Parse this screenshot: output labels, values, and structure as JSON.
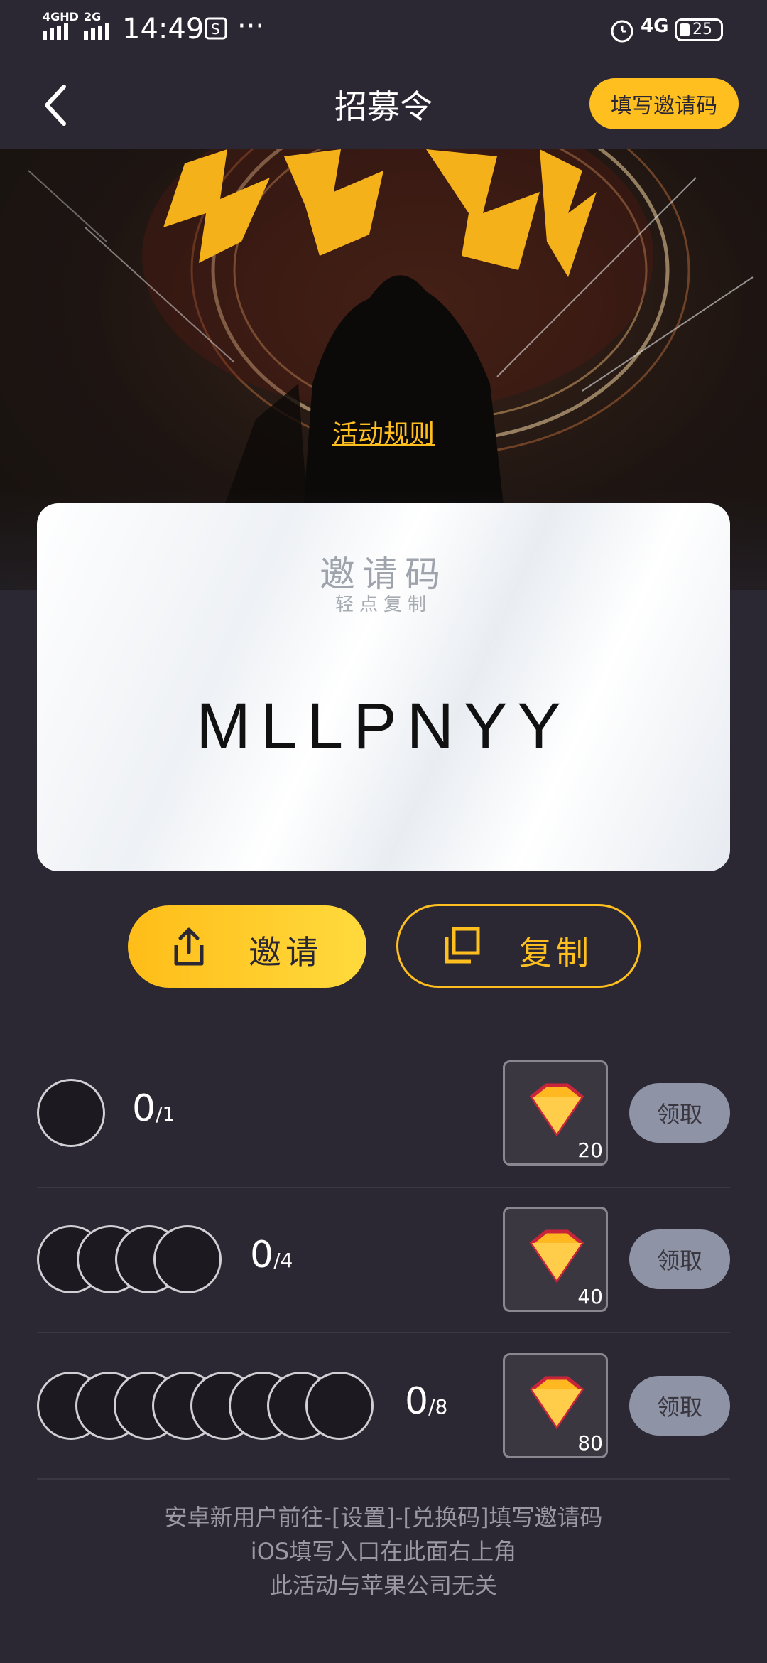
{
  "status_bar": {
    "network_left": "4GHD",
    "network_right": "2G",
    "time": "14:49",
    "more": "···",
    "right_network": "4G",
    "battery": "25"
  },
  "header": {
    "title": "招募令",
    "fill_code_label": "填写邀请码"
  },
  "banner": {
    "rules_link": "活动规则"
  },
  "card": {
    "title": "邀请码",
    "subtitle": "轻点复制",
    "code": "MLLPNYY"
  },
  "actions": {
    "invite_label": "邀请",
    "copy_label": "复制"
  },
  "rows": [
    {
      "count": "0",
      "total": "/1",
      "reward": "20",
      "claim": "领取"
    },
    {
      "count": "0",
      "total": "/4",
      "reward": "40",
      "claim": "领取"
    },
    {
      "count": "0",
      "total": "/8",
      "reward": "80",
      "claim": "领取"
    }
  ],
  "footer": {
    "line1": "安卓新用户前往-[设置]-[兑换码]填写邀请码",
    "line2": "iOS填写入口在此面右上角",
    "line3": "此活动与苹果公司无关"
  },
  "colors": {
    "accent": "#ffbf1f",
    "background": "#2b2833",
    "claim_button": "#8e93a6"
  }
}
